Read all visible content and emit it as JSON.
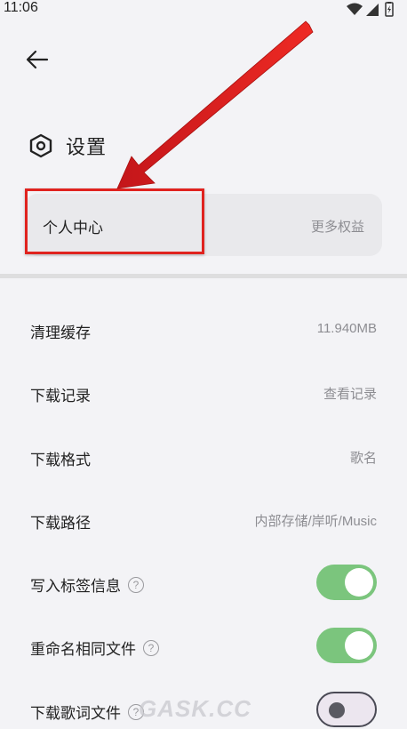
{
  "status_bar": {
    "time": "11:06"
  },
  "header": {
    "title": "设置"
  },
  "profile_card": {
    "label": "个人中心",
    "action": "更多权益"
  },
  "settings": [
    {
      "label": "清理缓存",
      "value": "11.940MB"
    },
    {
      "label": "下载记录",
      "value": "查看记录"
    },
    {
      "label": "下载格式",
      "value": "歌名"
    },
    {
      "label": "下载路径",
      "value": "内部存储/岸听/Music"
    }
  ],
  "toggles": [
    {
      "label": "写入标签信息",
      "state": "on"
    },
    {
      "label": "重命名相同文件",
      "state": "on"
    },
    {
      "label": "下载歌词文件",
      "state": "off"
    }
  ],
  "annotation": {
    "color": "#e0231f"
  },
  "watermark": "GASK.CC",
  "colors": {
    "toggle_on": "#7bc57d",
    "background": "#f3f3f6",
    "card": "#e9e9ec"
  }
}
